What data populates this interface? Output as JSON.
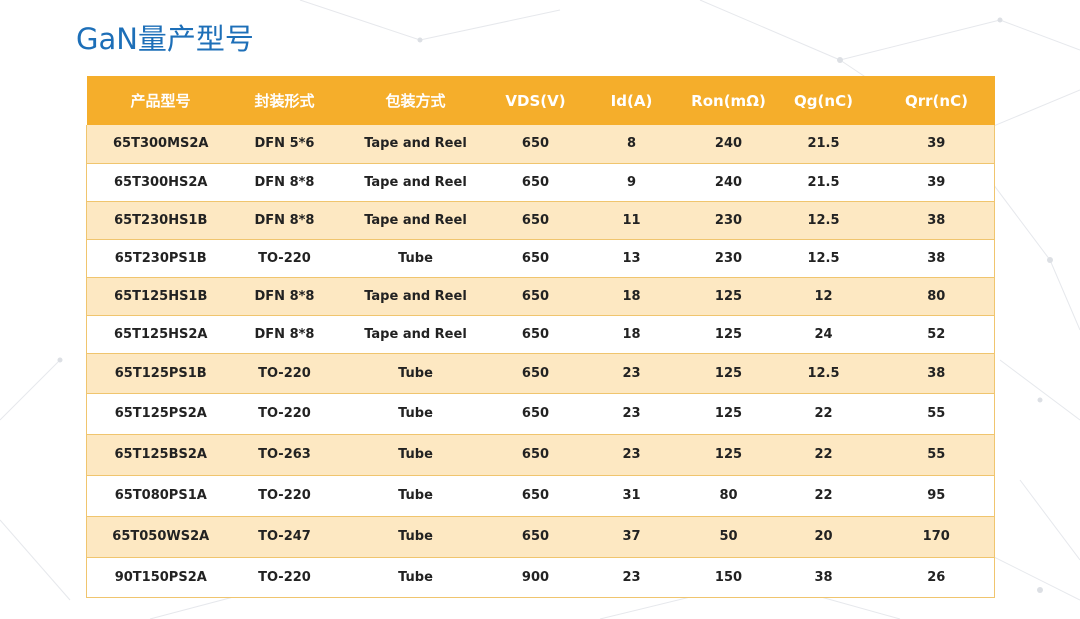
{
  "page": {
    "title": "GaN量产型号"
  },
  "table": {
    "headers": [
      "产品型号",
      "封装形式",
      "包装方式",
      "VDS(V)",
      "Id(A)",
      "Ron(mΩ)",
      "Qg(nC)",
      "Qrr(nC)"
    ],
    "rows": [
      [
        "65T300MS2A",
        "DFN 5*6",
        "Tape and Reel",
        "650",
        "8",
        "240",
        "21.5",
        "39"
      ],
      [
        "65T300HS2A",
        "DFN 8*8",
        "Tape and Reel",
        "650",
        "9",
        "240",
        "21.5",
        "39"
      ],
      [
        "65T230HS1B",
        "DFN 8*8",
        "Tape and Reel",
        "650",
        "11",
        "230",
        "12.5",
        "38"
      ],
      [
        "65T230PS1B",
        "TO-220",
        "Tube",
        "650",
        "13",
        "230",
        "12.5",
        "38"
      ],
      [
        "65T125HS1B",
        "DFN 8*8",
        "Tape and Reel",
        "650",
        "18",
        "125",
        "12",
        "80"
      ],
      [
        "65T125HS2A",
        "DFN 8*8",
        "Tape and Reel",
        "650",
        "18",
        "125",
        "24",
        "52"
      ],
      [
        "65T125PS1B",
        "TO-220",
        "Tube",
        "650",
        "23",
        "125",
        "12.5",
        "38"
      ],
      [
        "65T125PS2A",
        "TO-220",
        "Tube",
        "650",
        "23",
        "125",
        "22",
        "55"
      ],
      [
        "65T125BS2A",
        "TO-263",
        "Tube",
        "650",
        "23",
        "125",
        "22",
        "55"
      ],
      [
        "65T080PS1A",
        "TO-220",
        "Tube",
        "650",
        "31",
        "80",
        "22",
        "95"
      ],
      [
        "65T050WS2A",
        "TO-247",
        "Tube",
        "650",
        "37",
        "50",
        "20",
        "170"
      ],
      [
        "90T150PS2A",
        "TO-220",
        "Tube",
        "900",
        "23",
        "150",
        "38",
        "26"
      ]
    ]
  },
  "colors": {
    "title": "#1d6fb8",
    "header_bg": "#f5ae2b",
    "stripe_bg": "#fde8c2",
    "border": "#f0c56e"
  }
}
